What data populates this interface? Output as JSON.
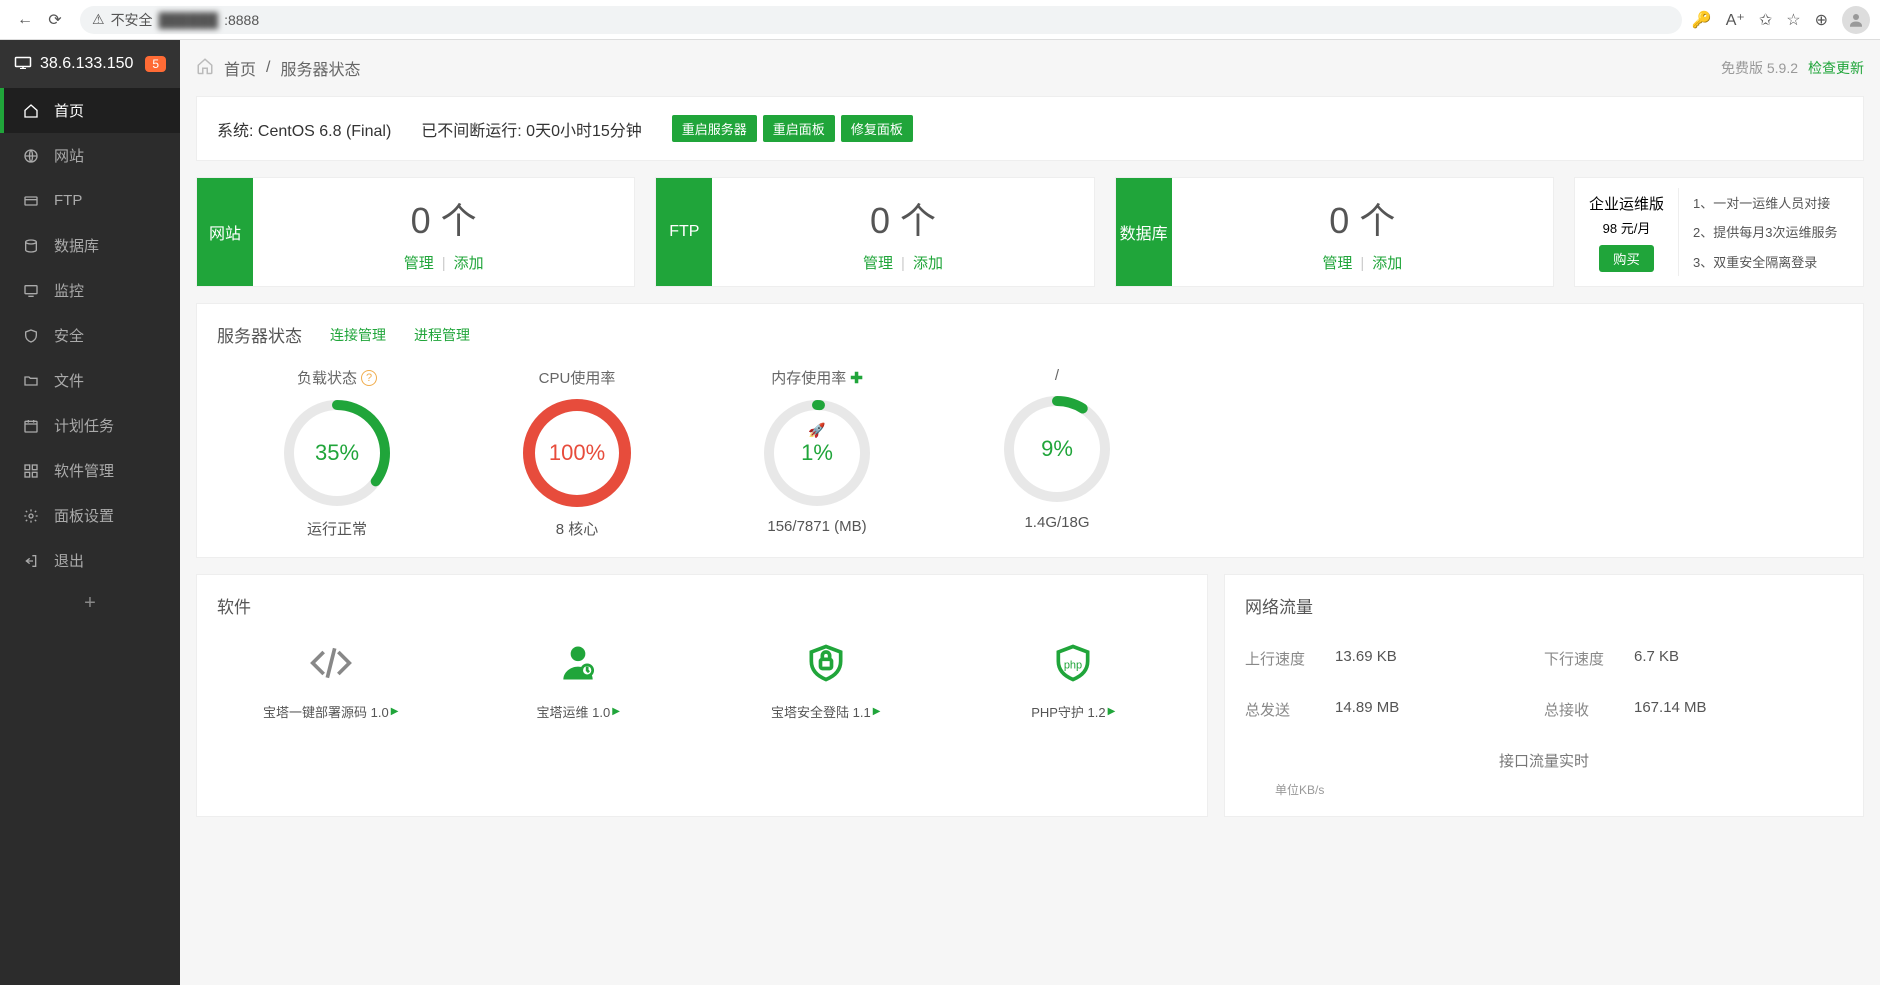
{
  "browser": {
    "insecure": "不安全",
    "addr_blur": "██████",
    "addr_suffix": ":8888"
  },
  "sidebar": {
    "ip": "38.6.133.150",
    "badge": "5",
    "items": [
      {
        "label": "首页",
        "icon": "home"
      },
      {
        "label": "网站",
        "icon": "globe"
      },
      {
        "label": "FTP",
        "icon": "ftp"
      },
      {
        "label": "数据库",
        "icon": "db"
      },
      {
        "label": "监控",
        "icon": "monitor"
      },
      {
        "label": "安全",
        "icon": "shield"
      },
      {
        "label": "文件",
        "icon": "folder"
      },
      {
        "label": "计划任务",
        "icon": "calendar"
      },
      {
        "label": "软件管理",
        "icon": "apps"
      },
      {
        "label": "面板设置",
        "icon": "gear"
      },
      {
        "label": "退出",
        "icon": "exit"
      }
    ]
  },
  "breadcrumb": {
    "home": "首页",
    "current": "服务器状态"
  },
  "version": {
    "text": "免费版 5.9.2",
    "check": "检查更新"
  },
  "system": {
    "os_label": "系统: CentOS 6.8 (Final)",
    "uptime": "已不间断运行: 0天0小时15分钟",
    "btn_restart_server": "重启服务器",
    "btn_restart_panel": "重启面板",
    "btn_repair_panel": "修复面板"
  },
  "cards": [
    {
      "tab": "网站",
      "count": "0 个",
      "manage": "管理",
      "add": "添加"
    },
    {
      "tab": "FTP",
      "count": "0 个",
      "manage": "管理",
      "add": "添加"
    },
    {
      "tab": "数据库",
      "count": "0 个",
      "manage": "管理",
      "add": "添加"
    }
  ],
  "promo": {
    "title": "企业运维版",
    "price": "98 元/月",
    "buy": "购买",
    "lines": [
      "1、一对一运维人员对接",
      "2、提供每月3次运维服务",
      "3、双重安全隔离登录"
    ]
  },
  "status": {
    "title": "服务器状态",
    "link_conn": "连接管理",
    "link_proc": "进程管理",
    "gauges": [
      {
        "title": "负载状态",
        "help": true,
        "value": "35%",
        "pct": 35,
        "color": "#20a53a",
        "sub": "运行正常"
      },
      {
        "title": "CPU使用率",
        "value": "100%",
        "pct": 100,
        "color": "#e74c3c",
        "sub": "8 核心",
        "thick": true
      },
      {
        "title": "内存使用率",
        "plus": true,
        "rocket": true,
        "value": "1%",
        "pct": 1,
        "color": "#20a53a",
        "sub": "156/7871 (MB)"
      },
      {
        "title": "/",
        "value": "9%",
        "pct": 9,
        "color": "#20a53a",
        "sub": "1.4G/18G"
      }
    ]
  },
  "software": {
    "title": "软件",
    "items": [
      {
        "label": "宝塔一键部署源码 1.0",
        "icon": "code",
        "gray": true
      },
      {
        "label": "宝塔运维 1.0",
        "icon": "ops"
      },
      {
        "label": "宝塔安全登陆 1.1",
        "icon": "lock"
      },
      {
        "label": "PHP守护 1.2",
        "icon": "php"
      }
    ]
  },
  "network": {
    "title": "网络流量",
    "up_label": "上行速度",
    "up_val": "13.69 KB",
    "down_label": "下行速度",
    "down_val": "6.7 KB",
    "sent_label": "总发送",
    "sent_val": "14.89 MB",
    "recv_label": "总接收",
    "recv_val": "167.14 MB",
    "chart_title": "接口流量实时",
    "unit": "单位KB/s"
  },
  "chart_data": [
    {
      "type": "gauge",
      "title": "负载状态",
      "value": 35,
      "max": 100,
      "sub": "运行正常"
    },
    {
      "type": "gauge",
      "title": "CPU使用率",
      "value": 100,
      "max": 100,
      "sub": "8 核心"
    },
    {
      "type": "gauge",
      "title": "内存使用率",
      "value": 1,
      "max": 100,
      "sub": "156/7871 (MB)"
    },
    {
      "type": "gauge",
      "title": "/",
      "value": 9,
      "max": 100,
      "sub": "1.4G/18G"
    }
  ]
}
